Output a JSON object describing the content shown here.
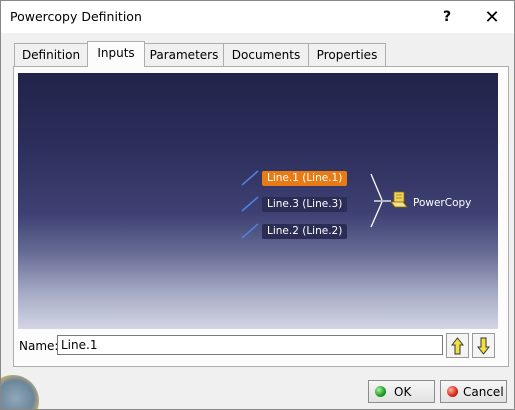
{
  "window": {
    "title": "Powercopy Definition"
  },
  "titlebar": {
    "help_label": "?",
    "close_label": "✕"
  },
  "tabs": [
    {
      "label": "Definition",
      "active": false
    },
    {
      "label": "Inputs",
      "active": true
    },
    {
      "label": "Parameters",
      "active": false
    },
    {
      "label": "Documents",
      "active": false
    },
    {
      "label": "Properties",
      "active": false
    }
  ],
  "viewer": {
    "inputs": [
      {
        "label": "Line.1 (Line.1)",
        "selected": true
      },
      {
        "label": "Line.3 (Line.3)",
        "selected": false
      },
      {
        "label": "Line.2 (Line.2)",
        "selected": false
      }
    ],
    "target_label": "PowerCopy",
    "colors": {
      "selected": "#e87b14",
      "label_bg": "#2c2d55",
      "line": "#4f7fd8"
    }
  },
  "name_field": {
    "label": "Name:",
    "value": "Line.1"
  },
  "buttons": {
    "ok_label": "OK",
    "cancel_label": "Cancel"
  },
  "icons": {
    "move_up": "up-arrow-icon",
    "move_down": "down-arrow-icon",
    "ok": "green-dot-icon",
    "cancel": "red-dot-icon",
    "powercopy": "powercopy-icon",
    "input": "line-icon"
  }
}
